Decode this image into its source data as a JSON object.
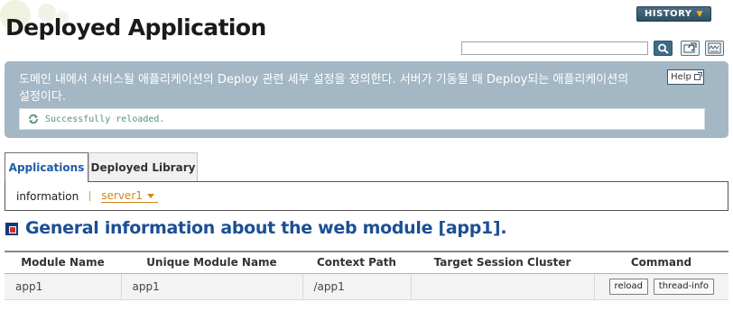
{
  "page": {
    "title": "Deployed Application"
  },
  "header": {
    "history_label": "HISTORY",
    "search_value": ""
  },
  "description": {
    "text": "도메인 내에서 서비스될 애플리케이션의 Deploy 관련 세부 설정을 정의한다. 서버가 기동될 때 Deploy되는 애플리케이션의 설정이다.",
    "help_label": "Help",
    "status_message": "Successfully reloaded."
  },
  "tabs": [
    {
      "label": "Applications",
      "active": true
    },
    {
      "label": "Deployed Library",
      "active": false
    }
  ],
  "info_bar": {
    "label": "information",
    "server_selected": "server1"
  },
  "section": {
    "title": "General information about the web module [app1]."
  },
  "table": {
    "columns": [
      "Module Name",
      "Unique Module Name",
      "Context Path",
      "Target Session Cluster",
      "Command"
    ],
    "rows": [
      {
        "module_name": "app1",
        "unique_module_name": "app1",
        "context_path": "/app1",
        "target_session_cluster": "",
        "commands": [
          "reload",
          "thread-info"
        ]
      }
    ]
  },
  "icons": {
    "history_chevron": "chevron-down-icon",
    "search": "search-icon",
    "refresh": "refresh-icon",
    "xml": "xml-icon",
    "help": "help-icon",
    "reload_status": "reload-icon",
    "section": "section-bullet-icon",
    "server_dropdown": "caret-down-icon"
  },
  "colors": {
    "title_blue": "#1b4f95",
    "active_tab_text": "#1f5ca8",
    "panel_bg": "#a3b7c5",
    "status_green": "#4f9378",
    "server_orange": "#d0871d",
    "history_bg": "#3b5d73"
  }
}
